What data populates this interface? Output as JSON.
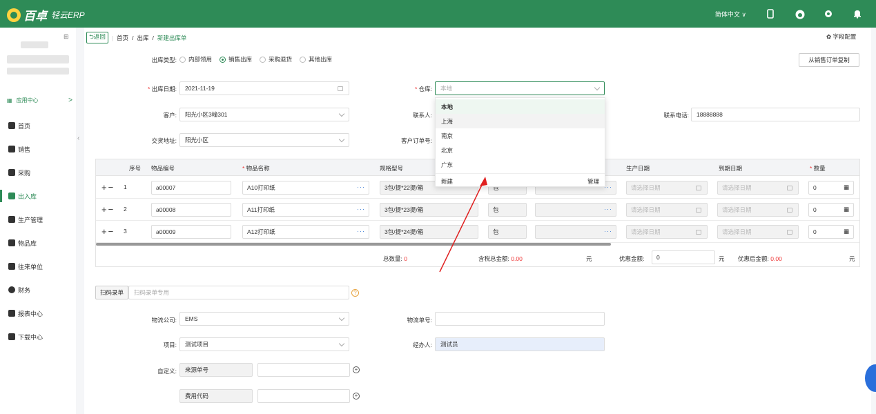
{
  "header": {
    "logo_name": "百卓",
    "logo_sub": "轻云ERP",
    "language": "简体中文 ∨",
    "bg_color": "#2e8b57"
  },
  "sidebar": {
    "app_center": "应用中心",
    "items": [
      {
        "label": "首页",
        "icon": "home-icon"
      },
      {
        "label": "销售",
        "icon": "sales-icon"
      },
      {
        "label": "采购",
        "icon": "cart-icon"
      },
      {
        "label": "出入库",
        "icon": "warehouse-icon",
        "active": true
      },
      {
        "label": "生产管理",
        "icon": "factory-icon"
      },
      {
        "label": "物品库",
        "icon": "goods-icon"
      },
      {
        "label": "往来单位",
        "icon": "contacts-icon"
      },
      {
        "label": "财务",
        "icon": "finance-icon"
      },
      {
        "label": "报表中心",
        "icon": "report-icon"
      },
      {
        "label": "下载中心",
        "icon": "download-icon"
      }
    ]
  },
  "breadcrumb": {
    "back": "返回",
    "items": [
      "首页",
      "出库",
      "新建出库单"
    ],
    "field_config": "字段配置"
  },
  "form": {
    "type_label": "出库类型:",
    "types": [
      "内部领用",
      "销售出库",
      "采购退货",
      "其他出库"
    ],
    "copy_btn": "从销售订单复制",
    "date_label": "出库日期:",
    "date_value": "2021-11-19",
    "warehouse_label": "仓库:",
    "warehouse_value": "本地",
    "customer_label": "客户:",
    "customer_value": "阳光小区3幢301",
    "contact_label": "联系人:",
    "phone_label": "联系电话:",
    "phone_value": "18888888",
    "address_label": "交货地址:",
    "address_value": "阳光小区",
    "order_no_label": "客户订单号:"
  },
  "dropdown": {
    "options": [
      "本地",
      "上海",
      "南京",
      "北京",
      "广东"
    ],
    "new": "新建",
    "manage": "管理"
  },
  "table": {
    "headers": [
      "序号",
      "物品编号",
      "物品名称",
      "规格型号",
      "生产日期",
      "到期日期",
      "数量"
    ],
    "date_placeholder": "请选择日期",
    "rows": [
      {
        "idx": "1",
        "code": "a00007",
        "name": "A10打印纸",
        "spec": "3包/提*22提/箱",
        "unit": "包",
        "qty": "0"
      },
      {
        "idx": "2",
        "code": "a00008",
        "name": "A11打印纸",
        "spec": "3包/提*23提/箱",
        "unit": "包",
        "qty": "0"
      },
      {
        "idx": "3",
        "code": "a00009",
        "name": "A12打印纸",
        "spec": "3包/提*24提/箱",
        "unit": "包",
        "qty": "0"
      }
    ],
    "total_qty_label": "总数量:",
    "total_qty": "0",
    "total_amount_label": "含税总金额:",
    "total_amount": "0.00",
    "yuan": "元",
    "discount_label": "优惠金额:",
    "discount_value": "0",
    "after_label": "优惠后金额:",
    "after_value": "0.00"
  },
  "bottom": {
    "scan_btn": "扫码录单",
    "scan_placeholder": "扫码录单专用",
    "logistics_label": "物流公司:",
    "logistics_value": "EMS",
    "tracking_label": "物流单号:",
    "project_label": "项目:",
    "project_value": "测试项目",
    "handler_label": "经办人:",
    "handler_value": "测试员",
    "custom_label": "自定义:",
    "custom1": "来源单号",
    "custom2": "费用代码"
  }
}
